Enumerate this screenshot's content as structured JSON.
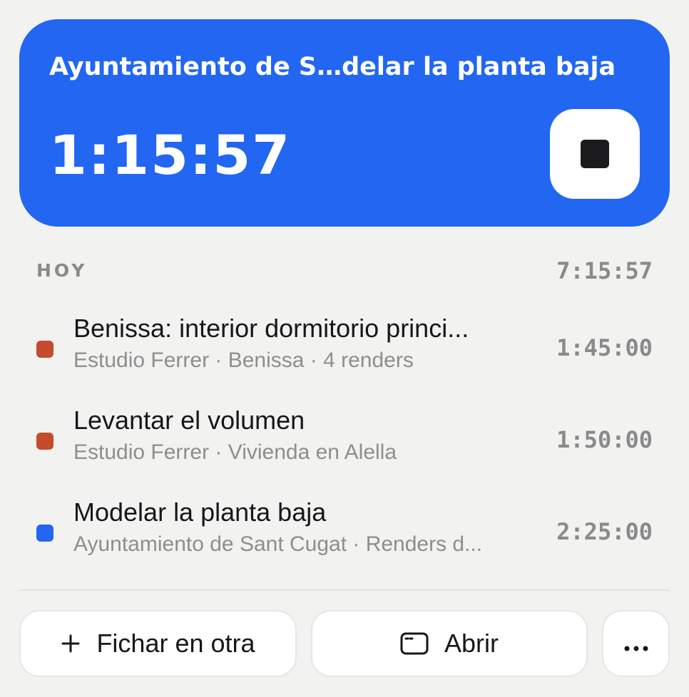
{
  "timer": {
    "title": "Ayuntamiento de S…delar la planta baja",
    "elapsed": "1:15:57",
    "accent_color": "#2266f1"
  },
  "section": {
    "label": "HOY",
    "total": "7:15:57"
  },
  "entries": [
    {
      "title": "Benissa: interior dormitorio princi...",
      "subtitle": "Estudio Ferrer · Benissa · 4 renders",
      "duration": "1:45:00",
      "color": "#c44b2b"
    },
    {
      "title": "Levantar el volumen",
      "subtitle": "Estudio Ferrer · Vivienda en Alella",
      "duration": "1:50:00",
      "color": "#c44b2b"
    },
    {
      "title": "Modelar la planta baja",
      "subtitle": "Ayuntamiento de Sant Cugat · Renders d...",
      "duration": "2:25:00",
      "color": "#2266f1"
    }
  ],
  "actions": {
    "clock_in_other": "Fichar en otra",
    "open": "Abrir",
    "more_icon": "more-horizontal-icon",
    "plus_icon": "plus-icon",
    "window_icon": "window-icon"
  }
}
